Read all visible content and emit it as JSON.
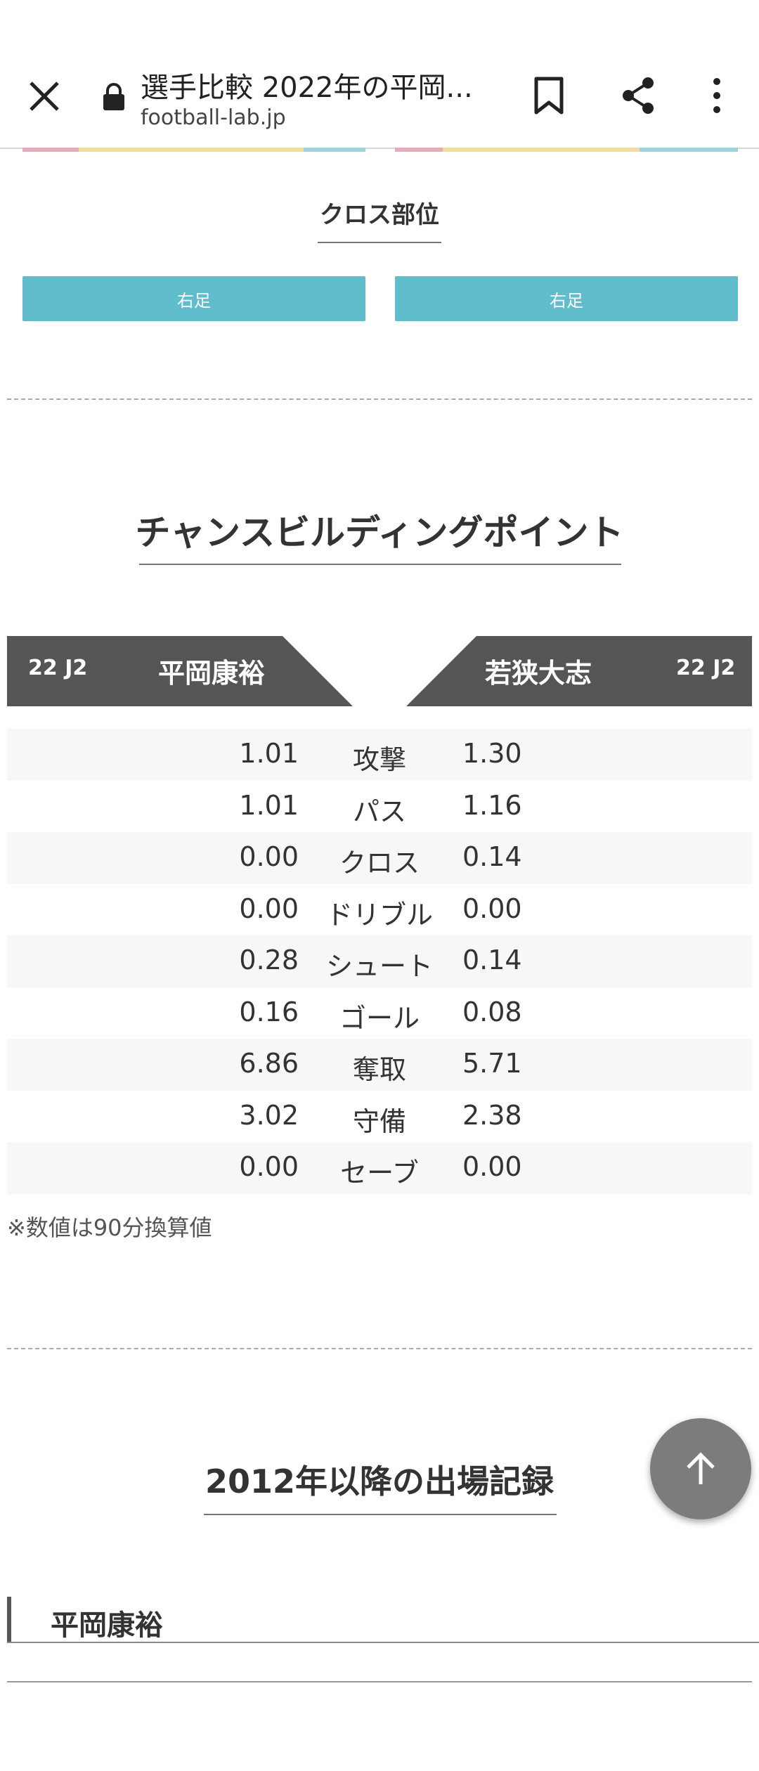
{
  "browser": {
    "title": "選手比較 2022年の平岡...",
    "domain": "football-lab.jp"
  },
  "icons": {
    "close": "close-icon",
    "lock": "lock-icon",
    "bookmark": "bookmark-icon",
    "share": "share-icon",
    "more": "more-vert-icon",
    "scroll_top": "arrow-up-icon"
  },
  "cross": {
    "title": "クロス部位",
    "left_value": "右足",
    "right_value": "右足",
    "color": "#61bccc"
  },
  "chance": {
    "title": "チャンスビルディングポイント",
    "left_player": {
      "season": "22 J2",
      "name": "平岡康裕"
    },
    "right_player": {
      "season": "22 J2",
      "name": "若狭大志"
    },
    "rows": [
      {
        "label": "攻撃",
        "left": "1.01",
        "right": "1.30"
      },
      {
        "label": "パス",
        "left": "1.01",
        "right": "1.16"
      },
      {
        "label": "クロス",
        "left": "0.00",
        "right": "0.14"
      },
      {
        "label": "ドリブル",
        "left": "0.00",
        "right": "0.00"
      },
      {
        "label": "シュート",
        "left": "0.28",
        "right": "0.14"
      },
      {
        "label": "ゴール",
        "left": "0.16",
        "right": "0.08"
      },
      {
        "label": "奪取",
        "left": "6.86",
        "right": "5.71"
      },
      {
        "label": "守備",
        "left": "3.02",
        "right": "2.38"
      },
      {
        "label": "セーブ",
        "left": "0.00",
        "right": "0.00"
      }
    ],
    "note": "※数値は90分換算値"
  },
  "records": {
    "title": "2012年以降の出場記録",
    "player": "平岡康裕"
  }
}
